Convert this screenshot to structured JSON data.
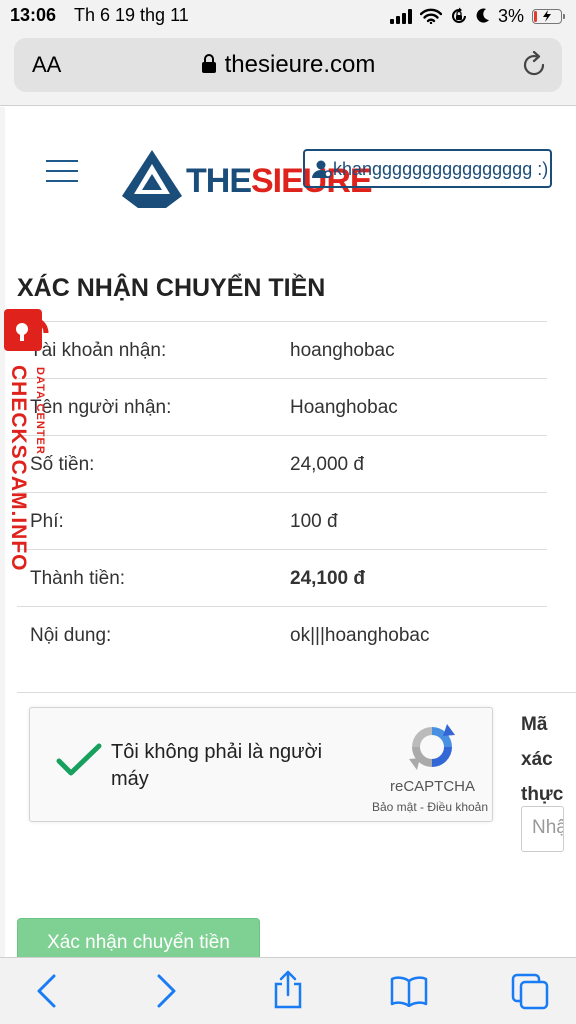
{
  "status_bar": {
    "time": "13:06",
    "date": "Th 6 19 thg 11",
    "battery": "3%",
    "battery_level": 0.03,
    "battery_color": "#e23b2f"
  },
  "browser": {
    "text_size_label": "AA",
    "url": "thesieure.com"
  },
  "header": {
    "logo_text_1": "THE",
    "logo_text_2": "SIEURE",
    "username": "khangggggggggggggggg :)"
  },
  "page": {
    "title": "XÁC NHẬN CHUYỂN TIỀN",
    "rows": [
      {
        "label": "Tài khoản nhận:",
        "value": "hoanghobac"
      },
      {
        "label": "Tên người nhận:",
        "value": "Hoanghobac"
      },
      {
        "label": "Số tiền:",
        "value": "24,000 đ"
      },
      {
        "label": "Phí:",
        "value": "100 đ"
      },
      {
        "label": "Thành tiền:",
        "value": "24,100 đ"
      },
      {
        "label": "Nội dung:",
        "value": "ok|||hoanghobac"
      }
    ],
    "captcha": {
      "text": "Tôi không phải là người máy",
      "brand": "reCAPTCHA",
      "links": "Bảo mật - Điều khoản"
    },
    "auth": {
      "label": "Mã xác thực",
      "placeholder": "Nhập mã"
    },
    "confirm_button": "Xác nhận chuyển tiền"
  },
  "watermark": {
    "main": "CHECKSCAM.INFO",
    "sub": "DATA CENTER"
  },
  "colors": {
    "brand_blue": "#1b4d7a",
    "brand_red": "#e0221c",
    "confirm_green": "#7fd193",
    "ios_blue": "#1a7cf5"
  },
  "toolbar": {
    "icons": [
      "back-icon",
      "forward-icon",
      "share-icon",
      "bookmarks-icon",
      "tabs-icon"
    ]
  }
}
